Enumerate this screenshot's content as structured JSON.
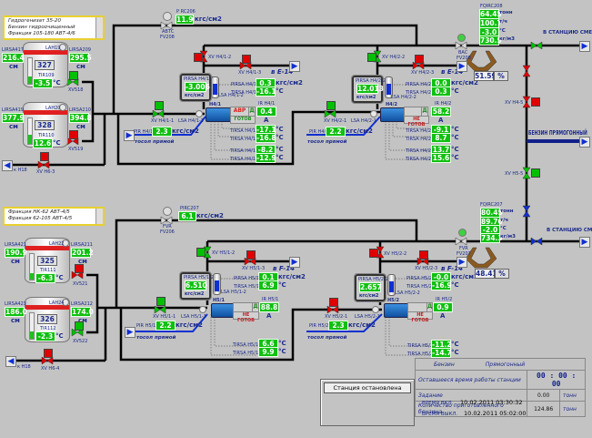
{
  "colors": {
    "value_bg": "#10c010",
    "pipe": "#000000",
    "coolant": "#1030d0",
    "gasoline": "#10208a",
    "valve_open": "#00c000",
    "valve_closed": "#e00000"
  },
  "top": {
    "list": [
      "Гидрогенизат 35-20",
      "Бензин гидроочищенный",
      "Фракция 105-180 АВТ-4/6"
    ],
    "tank1": {
      "lirs_l": "LIRSA417",
      "lirs_l_val": "216.4",
      "lirs_r": "LIRSA209",
      "lirs_r_val": "295.5",
      "unit": "см",
      "lamp": "LAH19",
      "num": "327",
      "tir": "TIR109",
      "tir_val": "-3.5",
      "tunit": "°С",
      "valve": "XV518"
    },
    "tank2": {
      "lirs_l": "LIRSA419",
      "lirs_l_val": "377.9",
      "lirs_r": "LIRSA210",
      "lirs_r_val": "394.8",
      "unit": "см",
      "lamp": "LAH20",
      "num": "328",
      "tir": "TIR110",
      "tir_val": "12.6",
      "tunit": "°С",
      "valve": "XV519"
    },
    "outlet": {
      "label": "к Н18",
      "valve": "XV Н6-3"
    },
    "fv": {
      "name": "FV208",
      "sub": "АВТС",
      "pic": "P RC206",
      "val": "11.9",
      "unit": "кгс/см2"
    },
    "p1": {
      "xv2": "XV Н4/1-2",
      "xv3": "XV Н4/1-3",
      "dest": "в Е-14",
      "pirsa2": "PIRSA Н4/1-2",
      "pirsa2_val": "-3.006",
      "pirsa2_unit": "кгс/см2",
      "lsa2": "LSA Н4/1-2",
      "pirsa4": "PIRSA Н4/1-4",
      "pirsa4_val": "0.3",
      "kgs": "кгс/см2",
      "tirsa5": "TIRSA Н4/1-5",
      "tirsa5_val": "-16.1",
      "c": "°С",
      "name": "Н4/1",
      "mode": "АВР",
      "d": "Д",
      "state": "ГОТОВ",
      "ir": "IR Н4/1",
      "ir_val": "0.4",
      "a": "А",
      "t4": "TIRSA Н4/1-4",
      "t4v": "-17.1",
      "t3": "TIRSA Н4/1-3",
      "t3v": "-16.8",
      "t1": "TIRSA Н4/1-1",
      "t1v": "-8.2",
      "t2": "TIRSA Н4/1-2",
      "t2v": "-12.9",
      "xv1": "XV Н4/1-1",
      "lsa1": "LSA Н4/1-1",
      "pir": "PIR Н4/1-5",
      "pir_val": "2.3",
      "coolant": "тосол прямой"
    },
    "p2": {
      "xv2": "XV Н4/2-2",
      "xv3": "XV Н4/2-3",
      "dest": "в Е-14",
      "pirsa2": "PIRSA Н4/2-2",
      "pirsa2_val": "12.013",
      "pirsa2_unit": "кгс/см2",
      "lsa2": "LSA Н4/2-2",
      "pirsa4": "PIRSA Н4/2-4",
      "pirsa4_val": "0.0",
      "kgs": "кгс/см2",
      "tirsa5": "TIRSA Н4/2-5",
      "tirsa5_val": "0.3",
      "c": "°С",
      "name": "Н4/2",
      "mode": "",
      "d": "Д",
      "state": "НЕ ГОТОВ",
      "ir": "IR Н4/2",
      "ir_val": "58.2",
      "a": "А",
      "t4": "TIRSA Н4/2-4",
      "t4v": "-9.1",
      "t3": "TIRSA Н4/2-3",
      "t3v": "8.7",
      "t1": "TIRSA Н4/2-1",
      "t1v": "13.7",
      "t2": "TIRSA Н4/2-2",
      "t2v": "15.6",
      "xv1": "XV Н4/2-1",
      "lsa1": "LSA Н4/2-1",
      "pir": "PIR Н4/2-5",
      "pir_val": "2.2",
      "coolant": "тосол прямой"
    },
    "fq": {
      "tag": "FQIRC208",
      "v1": "64.45",
      "u1": "тонн",
      "v2": "100.7",
      "u2": "т/ч",
      "v3": "-3.0",
      "u3": "°С",
      "v4": "730.5",
      "u4": "кг/м3",
      "valve": "FV208",
      "valve_sub": "ВАС",
      "pos": "51.59",
      "pct": "%"
    },
    "dest": "В СТАНЦИЮ СМЕШЕНИЯ"
  },
  "right": {
    "xv_h45": "XV Н4-5",
    "xv_h55": "XV Н5-5",
    "straight": "БЕНЗИН ПРЯМОГОННЫЙ"
  },
  "bottom": {
    "list": [
      "Фракция НК-62 АВТ-4/5",
      "Фракция 62-105 АВТ-4/5"
    ],
    "tank1": {
      "lirs_l": "LIRSA421",
      "lirs_l_val": "190.9",
      "lirs_r": "LIRSA211",
      "lirs_r_val": "201.2",
      "unit": "см",
      "lamp": "LAH22",
      "num": "325",
      "tir": "TIR111",
      "tir_val": "-6.3",
      "tunit": "°С",
      "valve": "XV521"
    },
    "tank2": {
      "lirs_l": "LIRSA423",
      "lirs_l_val": "186.0",
      "lirs_r": "LIRSA212",
      "lirs_r_val": "174.0",
      "unit": "см",
      "lamp": "LAH24",
      "num": "326",
      "tir": "TIR112",
      "tir_val": "-2.3",
      "tunit": "°С",
      "valve": "XV522"
    },
    "outlet": {
      "label": "к Н18",
      "valve": "XV Н6-4"
    },
    "fv": {
      "name": "FV206",
      "sub": "FVR",
      "pic": "PIRC207",
      "val": "6.1",
      "unit": "кгс/см2"
    },
    "p1": {
      "xv2": "XV Н5/1-2",
      "xv3": "XV Н5/1-3",
      "dest": "в F-14",
      "pirsa2": "PIRSA Н5/1-2",
      "pirsa2_val": "6.510",
      "pirsa2_unit": "кгс/см2",
      "lsa2": "LSA Н5/1-2",
      "pirsa4": "PIRSA Н5/1-4",
      "pirsa4_val": "0.1",
      "kgs": "кгс/см2",
      "tirsa5": "TIRSA Н5/1-5",
      "tirsa5_val": "6.9",
      "c": "°С",
      "name": "Н5/1",
      "d": "Д",
      "state": "НЕ ГОТОВ",
      "ir": "IR Н5/1",
      "ir_val": "88.8",
      "a": "А",
      "t1": "TIRSA Н5/1-1",
      "t1v": "6.6",
      "t2": "TIRSA Н5/1-2",
      "t2v": "9.9",
      "xv1": "XV Н5/1-1",
      "lsa1": "LSA Н5/1-1",
      "pir": "PIR Н5/1-5",
      "pir_val": "2.2",
      "coolant": "тосол прямой"
    },
    "p2": {
      "xv2": "XV Н5/2-2",
      "xv3": "XV Н5/2-3",
      "dest": "в F-14",
      "pirsa2": "PIRSA Н5/2-2",
      "pirsa2_val": "2.657",
      "pirsa2_unit": "кгс/см2",
      "lsa2": "LSA Н5/2-2",
      "pirsa4": "PIRSA Н5/2-4",
      "pirsa4_val": "-0.0",
      "kgs": "кгс/см2",
      "tirsa5": "TIRSA Н5/2-5",
      "tirsa5_val": "-16.9",
      "c": "°С",
      "name": "Н5/2",
      "d": "Д",
      "state": "НЕ ГОТОВ",
      "ir": "IR Н5/2",
      "ir_val": "0.9",
      "a": "А",
      "t1": "TIRSA Н5/2-1",
      "t1v": "-11.2",
      "t2": "TIRSA Н5/2-2",
      "t2v": "-14.7",
      "xv1": "XV Н5/2-1",
      "lsa1": "LSA Н5/2-1",
      "pir": "PIR Н5/2-5",
      "pir_val": "2.3",
      "coolant": "тосол прямой"
    },
    "fq": {
      "tag": "FQIRC207",
      "v1": "80.45",
      "u1": "тонн",
      "v2": "89.70",
      "u2": "т/ч",
      "v3": "-2.0",
      "u3": "°С",
      "v4": "734.3",
      "u4": "кг/м3",
      "valve": "FV207",
      "valve_sub": "FVR",
      "pos": "48.41",
      "pct": "%"
    },
    "dest": "В СТАНЦИЮ СМЕШЕНИЯ"
  },
  "panel": {
    "status": "Станция остановлена",
    "h1": "Бензин",
    "h2": "Прямогонный",
    "r1": "Оставшееся время работы станции",
    "r1v": "00 : 00 : 00",
    "r2": "Задание",
    "r2v": "0.00",
    "r2u": "тонн",
    "r3": "Количество приготовленного бензина",
    "r3v": "124.86",
    "r3u": "тонн",
    "on_label": "ВРЕМЯ ВКЛ.",
    "on_val": "10.02.2011 03:30:32",
    "off_label": "ВРЕМЯ ВЫКЛ.",
    "off_val": "10.02.2011 05:02:00"
  }
}
